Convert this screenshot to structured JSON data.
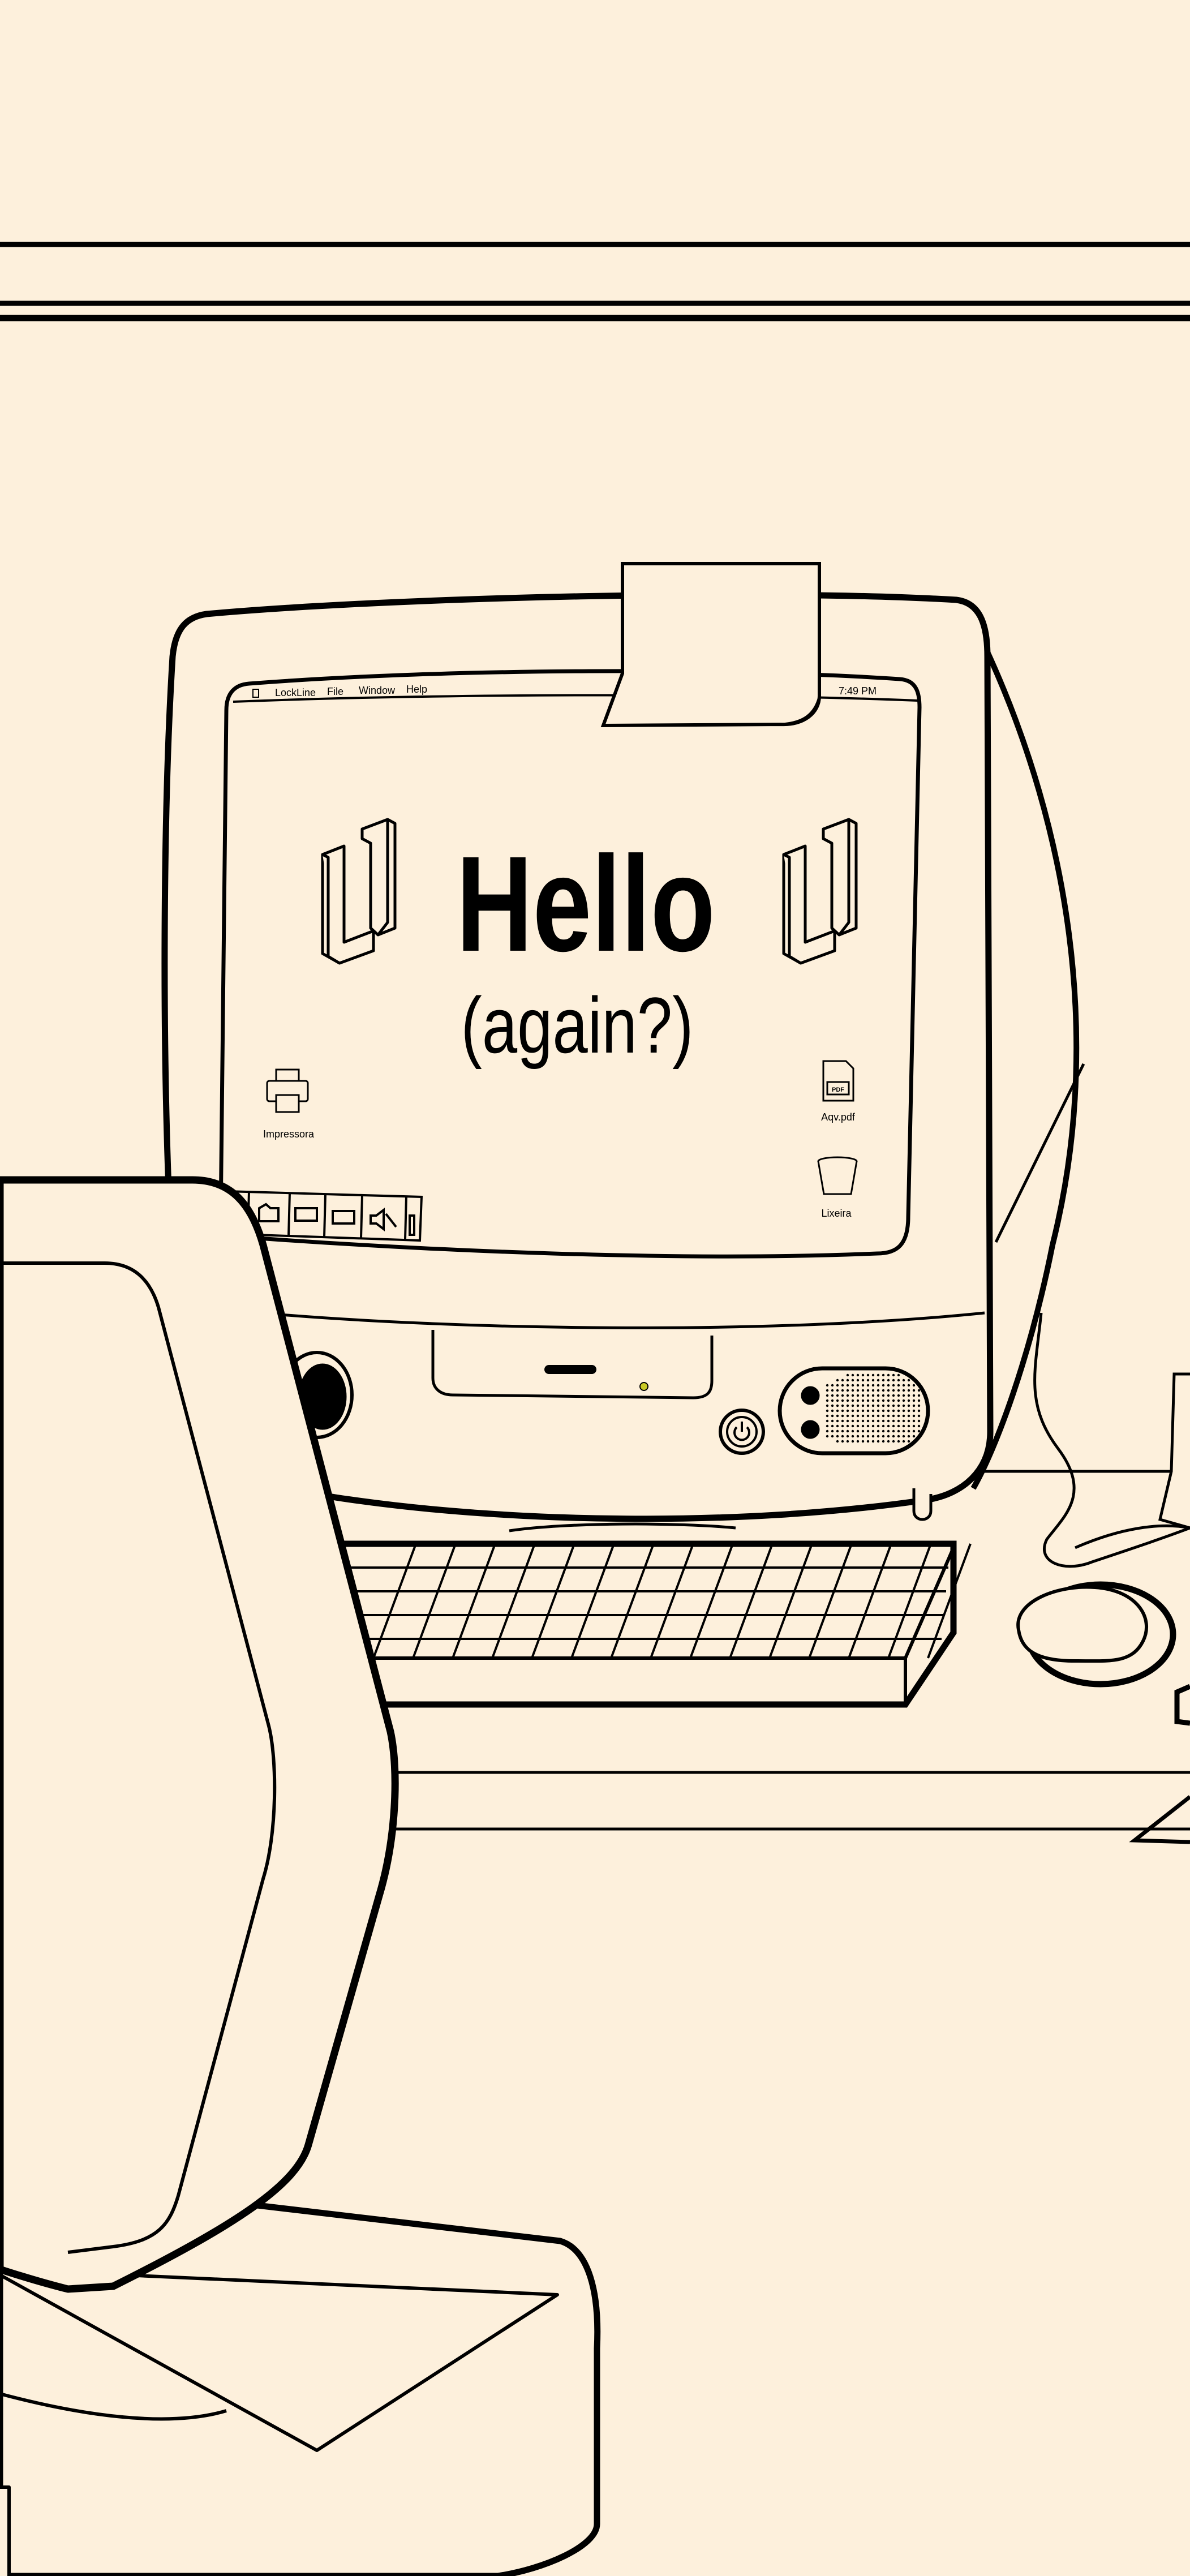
{
  "menu_bar": {
    "app_name": "LockLine",
    "items": [
      "File",
      "Window",
      "Help"
    ],
    "clock": "7:49 PM"
  },
  "screen": {
    "headline": "Hello",
    "subheadline": "(again?)"
  },
  "desktop_icons": {
    "printer": {
      "label": "Impressora",
      "icon": "printer-icon"
    },
    "pdf": {
      "label": "Aqv.pdf",
      "badge": "PDF",
      "icon": "pdf-file-icon"
    },
    "trash": {
      "label": "Lixeira",
      "icon": "trash-icon"
    }
  },
  "dock": {
    "icons": [
      "finder-icon",
      "folder-icon",
      "calendar-icon",
      "keyboard-icon",
      "speaker-muted-icon",
      "divider-icon"
    ]
  },
  "colors": {
    "background": "#FDF0DC",
    "line": "#000000",
    "power_led": "#C9C926"
  }
}
